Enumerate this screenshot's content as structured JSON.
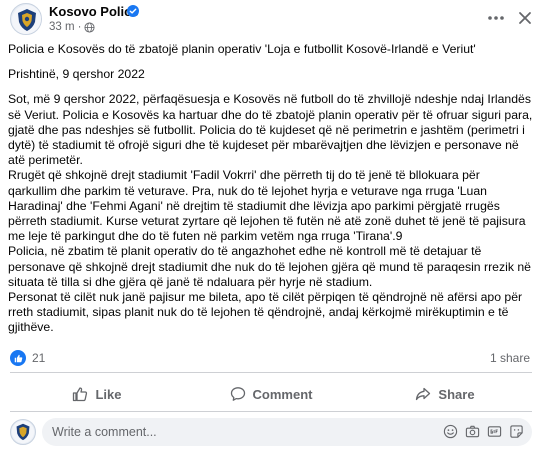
{
  "header": {
    "page_name": "Kosovo Police",
    "time": "33 m",
    "separator": "·"
  },
  "post": {
    "paragraphs": [
      "Policia e Kosovës do të zbatojë planin operativ 'Loja e futbollit Kosovë-Irlandë e Veriut'",
      "Prishtinë, 9 qershor 2022",
      "Sot, më 9 qershor 2022, përfaqësuesja e Kosovës në futboll do të zhvillojë ndeshje ndaj Irlandës\nsë Veriut. Policia e Kosovës ka hartuar dhe do të zbatojë planin operativ për të ofruar siguri para,\ngjatë dhe pas ndeshjes së futbollit. Policia do të kujdeset që në perimetrin e jashtëm (perimetri i\ndytë) të stadiumit të ofrojë siguri dhe të kujdeset për mbarëvajtjen dhe lëvizjen e personave në\natë perimetër.\nRrugët që shkojnë drejt stadiumit 'Fadil Vokrri' dhe përreth tij do të jenë të bllokuara për\nqarkullim dhe parkim të veturave. Pra, nuk do të lejohet hyrja e veturave nga rruga 'Luan\nHaradinaj' dhe 'Fehmi Agani' në drejtim të stadiumit dhe lëvizja apo parkimi përgjatë rrugës\npërreth stadiumit. Kurse veturat zyrtare që lejohen të futën në atë zonë duhet të jenë të pajisura\nme leje të parkingut dhe do të futen në parkim vetëm nga rruga 'Tirana'.9\nPolicia, në zbatim të planit operativ do të angazhohet edhe në kontroll më të detajuar të\npersonave që shkojnë drejt stadiumit dhe nuk do të lejohen gjëra që mund të paraqesin rrezik në\nsituata të tilla si dhe gjëra që janë të ndaluara për hyrje në stadium.\nPersonat të cilët nuk janë pajisur me bileta, apo të cilët përpiqen të qëndrojnë në afërsi apo për\nrreth stadiumit, sipas planit nuk do të lejohen të qëndrojnë, andaj kërkojmë mirëkuptimin e të\ngjithëve."
    ]
  },
  "stats": {
    "reaction_count": "21",
    "share_count": "1 share"
  },
  "actions": {
    "like_label": "Like",
    "comment_label": "Comment",
    "share_label": "Share"
  },
  "comment": {
    "placeholder": "Write a comment..."
  },
  "colors": {
    "brand": "#1877f2",
    "secondary_text": "#65676b",
    "divider": "#ced0d4",
    "input_bg": "#f0f2f5"
  }
}
